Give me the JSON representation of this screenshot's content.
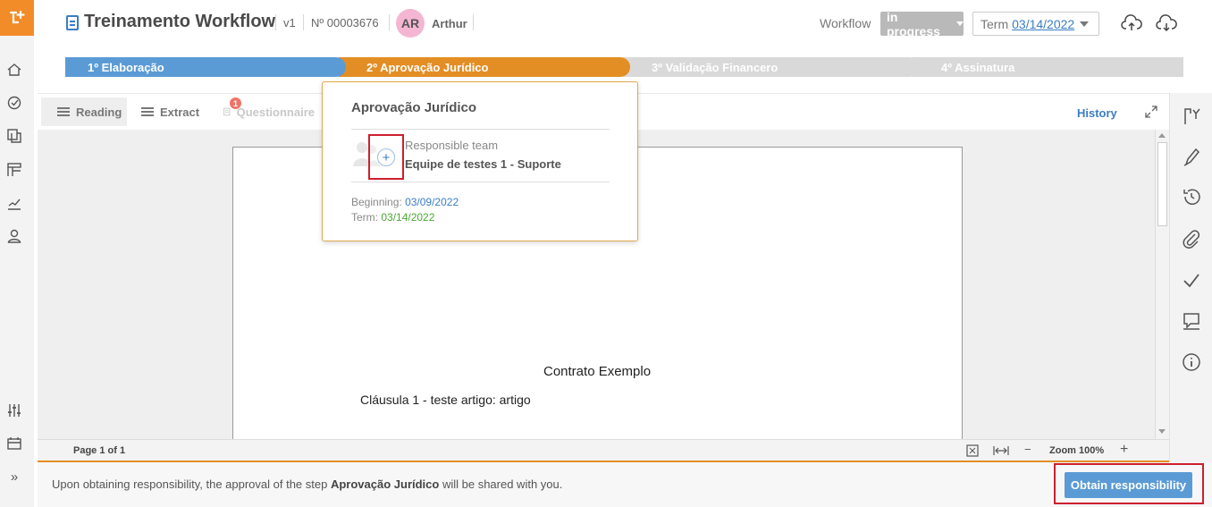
{
  "header": {
    "title": "Treinamento Workflow",
    "version": "v1",
    "number": "Nº 00003676",
    "user_initials": "AR",
    "user_name": "Arthur",
    "workflow_label": "Workflow",
    "status": "in progress",
    "term_label": "Term",
    "term_date": "03/14/2022"
  },
  "steps": [
    {
      "label": "1º Elaboração",
      "state": "done",
      "color": "#5b9bd5"
    },
    {
      "label": "2º Aprovação Jurídico",
      "state": "current",
      "color": "#e38e24"
    },
    {
      "label": "3º Validação Financero",
      "state": "pending",
      "color": "#d9d9d9"
    },
    {
      "label": "4º Assinatura",
      "state": "pending",
      "color": "#d9d9d9"
    }
  ],
  "toolbar": {
    "tabs": [
      {
        "label": "Reading",
        "active": true
      },
      {
        "label": "Extract",
        "active": false
      },
      {
        "label": "Questionnaire",
        "active": false,
        "badge": "1"
      }
    ],
    "history_label": "History"
  },
  "document": {
    "title": "Contrato Exemplo",
    "clause": "Cláusula 1 - teste artigo: artigo"
  },
  "statusbar": {
    "page_info": "Page 1 of 1",
    "zoom_minus": "−",
    "zoom_label": "Zoom 100%",
    "zoom_plus": "+"
  },
  "popover": {
    "title": "Aprovação Jurídico",
    "responsible_label": "Responsible team",
    "responsible_team": "Equipe de testes 1 - Suporte",
    "add_symbol": "+",
    "beginning_label": "Beginning:",
    "beginning_date": "03/09/2022",
    "term_label": "Term:",
    "term_date": "03/14/2022"
  },
  "bottom": {
    "message_prefix": "Upon obtaining responsibility, the approval of the step ",
    "message_step": "Aprovação Jurídico",
    "message_suffix": " will be shared with you.",
    "obtain_button": "Obtain responsibility"
  },
  "left_sidebar": {
    "items": [
      "home-icon",
      "workflow-icon",
      "documents-icon",
      "templates-icon",
      "reports-icon",
      "user-icon",
      "settings-sliders-icon",
      "calendar-icon",
      "expand-chevron-icon"
    ],
    "expand_symbol": "»"
  },
  "right_sidebar": {
    "items": [
      "flow-icon",
      "pen-icon",
      "history-icon",
      "attachment-icon",
      "check-icon",
      "comment-icon",
      "info-icon"
    ]
  },
  "colors": {
    "accent_orange": "#e38e24",
    "accent_blue": "#5b9bd5",
    "link_blue": "#3b7dc4",
    "highlight_red": "#cc1f2e"
  }
}
